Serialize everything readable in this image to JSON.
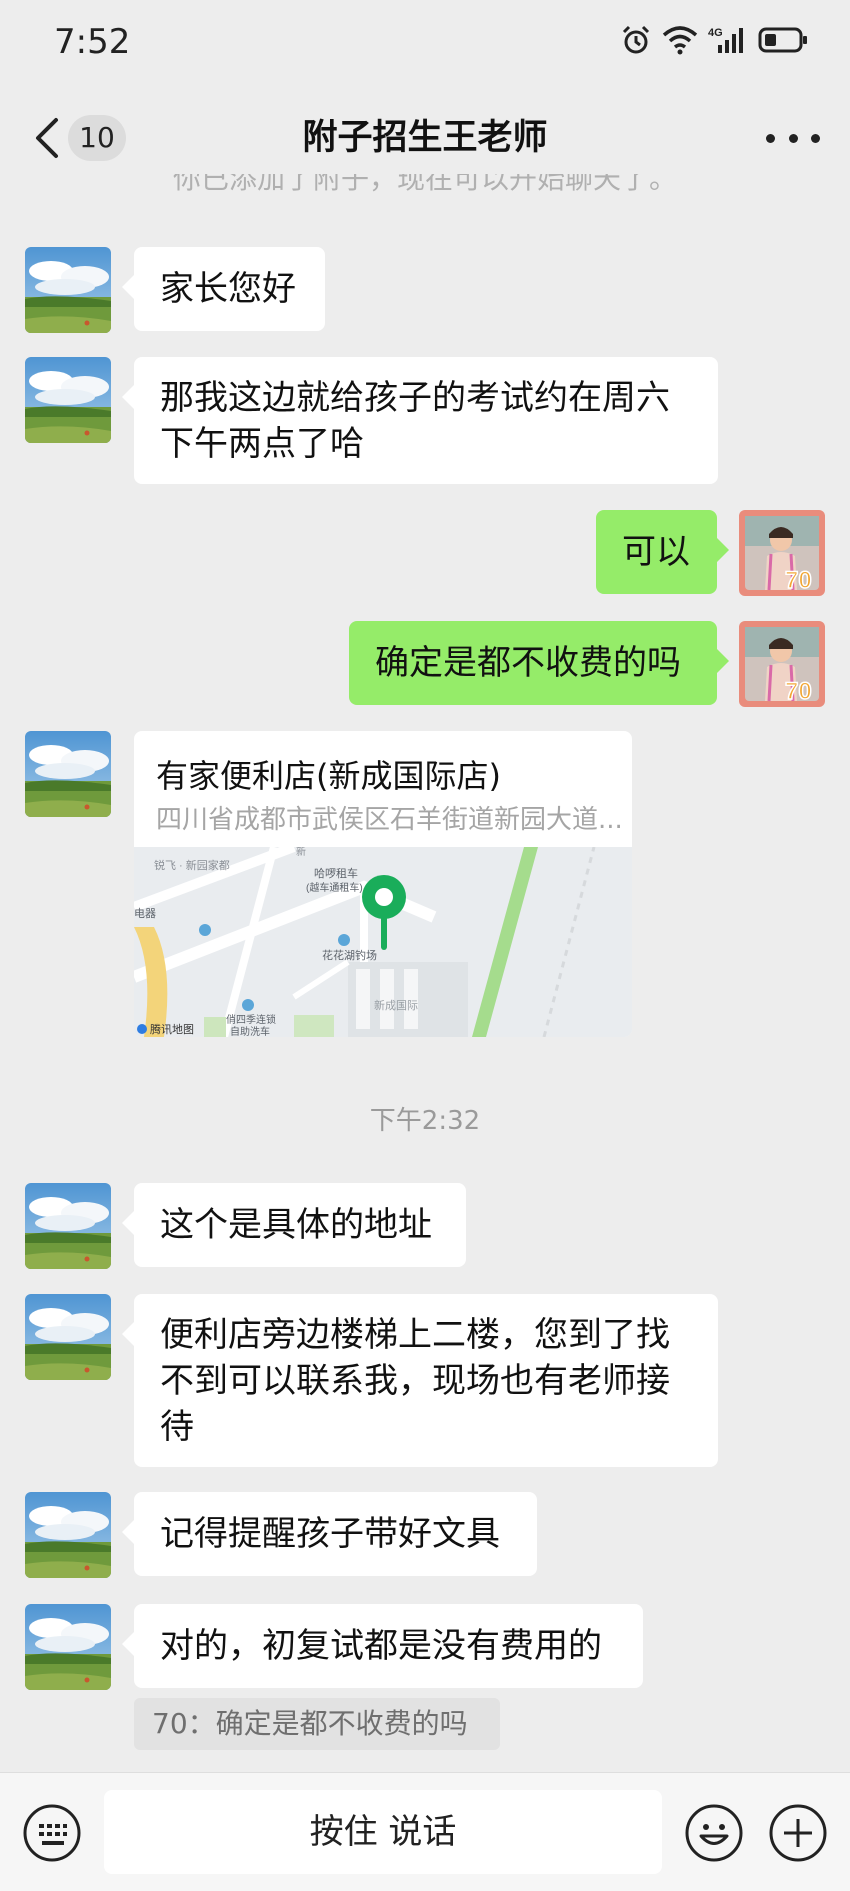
{
  "status": {
    "time": "7:52",
    "network": "4G"
  },
  "nav": {
    "badge": "10",
    "title": "附子招生王老师"
  },
  "system_note": "你已添加了附子，现在可以开始聊天了。",
  "messages": {
    "m1": "家长您好",
    "m2_line1": "那我这边就给孩子的考试约在周六",
    "m2_line2": "下午两点了哈",
    "m3": "可以",
    "m4": "确定是都不收费的吗",
    "m6": "这个是具体的地址",
    "m7_line1": "便利店旁边楼梯上二楼，您到了找",
    "m7_line2": "不到可以联系我，现场也有老师接",
    "m7_line3": "待",
    "m8": "记得提醒孩子带好文具",
    "m9": "对的，初复试都是没有费用的"
  },
  "location": {
    "name": "有家便利店(新成国际店)",
    "address": "四川省成都市武侯区石羊街道新园大道...",
    "map_labels": {
      "l1": "锐飞 · 新园家都",
      "l2": "哈啰租车",
      "l3": "(越车通租车)",
      "l4": "电器",
      "l5": "花花湖钓场",
      "l6": "新成国际",
      "l7": "俏四季连锁",
      "l8": "自助洗车",
      "l9": "腾讯地图",
      "l10": "新"
    }
  },
  "time_separator": "下午2:32",
  "quote": "70：确定是都不收费的吗",
  "input": {
    "voice_label": "按住 说话"
  },
  "colors": {
    "background": "#ededed",
    "bubble_out": "#95ec69",
    "bubble_in": "#ffffff",
    "map_pin": "#1aad5a"
  }
}
